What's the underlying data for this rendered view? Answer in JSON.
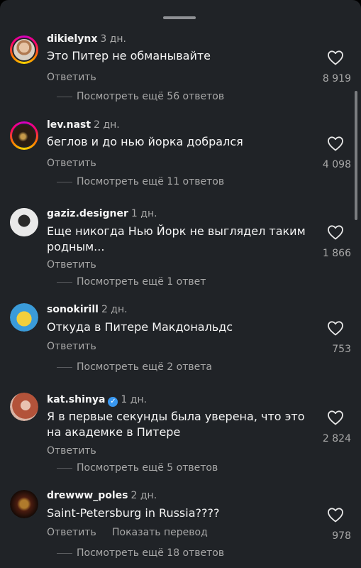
{
  "comments": [
    {
      "username": "dikielynx",
      "time": "3 дн.",
      "text": "Это Питер не обманывайте",
      "reply": "Ответить",
      "likes": "8 919",
      "more": "Посмотреть ещё 56 ответов",
      "verified": false
    },
    {
      "username": "lev.nast",
      "time": "2 дн.",
      "text": "беглов и до нью йорка добрался",
      "reply": "Ответить",
      "likes": "4 098",
      "more": "Посмотреть ещё 11 ответов",
      "verified": false
    },
    {
      "username": "gaziz.designer",
      "time": "1 дн.",
      "text": "Еще никогда Нью Йорк не выглядел таким родным...",
      "reply": "Ответить",
      "likes": "1 866",
      "more": "Посмотреть ещё 1 ответ",
      "verified": false
    },
    {
      "username": "sonokirill",
      "time": "2 дн.",
      "text": "Откуда в Питере Макдональдс",
      "reply": "Ответить",
      "likes": "753",
      "more": "Посмотреть ещё 2 ответа",
      "verified": false
    },
    {
      "username": "kat.shinya",
      "time": "1 дн.",
      "text": "Я в первые секунды была уверена, что это на академке в Питере",
      "reply": "Ответить",
      "likes": "2 824",
      "more": "Посмотреть ещё 5 ответов",
      "verified": true
    },
    {
      "username": "drewww_poles",
      "time": "2 дн.",
      "text": "Saint-Petersburg in Russia????",
      "reply": "Ответить",
      "translate": "Показать перевод",
      "likes": "978",
      "more": "Посмотреть ещё 18 ответов",
      "verified": false
    }
  ],
  "icons": {
    "like": "heart-outline-icon",
    "verified": "verified-badge-icon"
  },
  "colors": {
    "background": "#202327",
    "secondary_text": "#a8a8a8",
    "verified": "#3897f0"
  }
}
